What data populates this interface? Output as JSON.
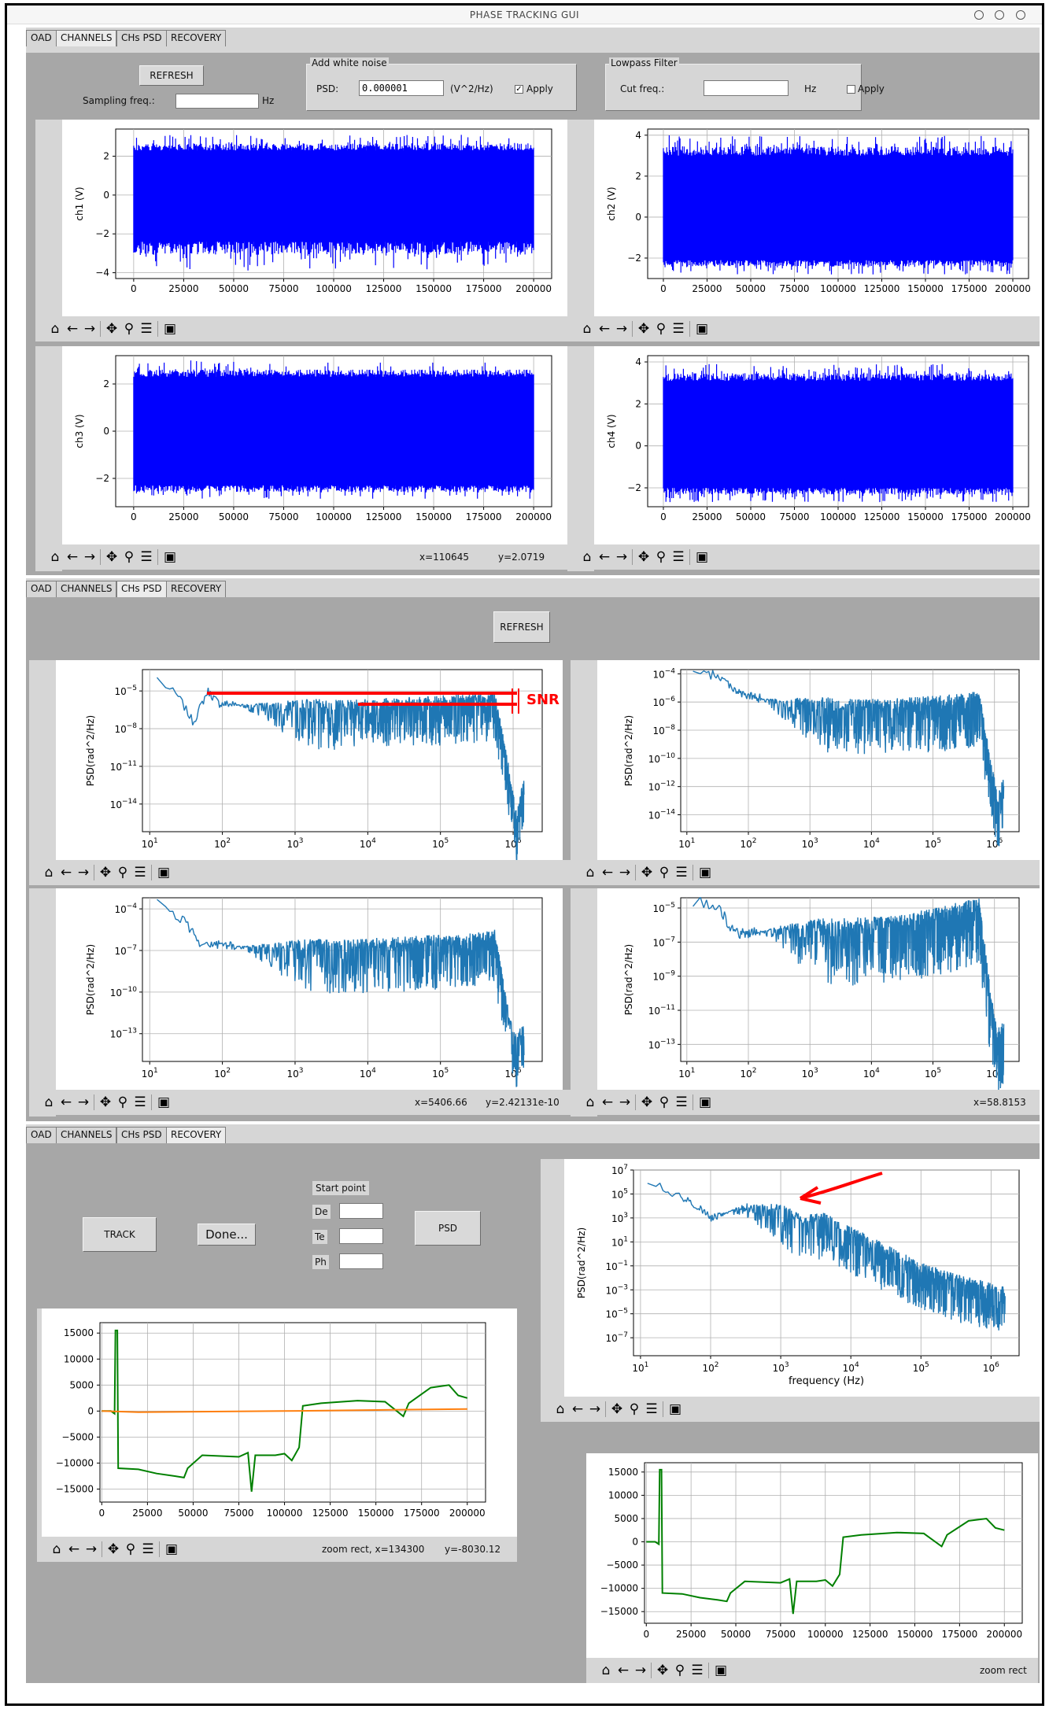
{
  "window": {
    "title": "PHASE TRACKING GUI"
  },
  "tabs": [
    "OAD",
    "CHANNELS",
    "CHs PSD",
    "RECOVERY"
  ],
  "panel1": {
    "refresh_label": "REFRESH",
    "sampling_label": "Sampling freq.:",
    "sampling_value": "",
    "hz_label": "Hz",
    "noise": {
      "title": "Add white noise",
      "psd_label": "PSD:",
      "psd_value": "0.000001",
      "unit": "(V^2/Hz)",
      "apply_label": "Apply",
      "apply_checked": true
    },
    "lowpass": {
      "title": "Lowpass Filter",
      "cut_label": "Cut freq.:",
      "cut_value": "",
      "hz_label": "Hz",
      "apply_label": "Apply",
      "apply_checked": false
    },
    "status_bottom_left": {
      "x": "x=110645",
      "y": "y=2.0719"
    }
  },
  "panel2": {
    "refresh_label": "REFRESH",
    "snr_label": "SNR",
    "status_bottom_left": {
      "x": "x=5406.66",
      "y": "y=2.42131e-10"
    },
    "status_bottom_right": {
      "x": "x=58.8153"
    }
  },
  "panel3": {
    "track_label": "TRACK",
    "done_label": "Done...",
    "psd_label": "PSD",
    "start_point_label": "Start point",
    "fields": [
      {
        "label": "De",
        "value": ""
      },
      {
        "label": "Te",
        "value": ""
      },
      {
        "label": "Ph",
        "value": ""
      }
    ],
    "status_left": {
      "x": "zoom rect, x=134300",
      "y": "y=-8030.12"
    },
    "status_right": "zoom rect"
  },
  "toolbar_icons": [
    "home-icon",
    "back-arrow-icon",
    "forward-arrow-icon",
    "pan-icon",
    "zoom-icon",
    "configure-subplots-icon",
    "save-icon"
  ],
  "colors": {
    "time_series": "#0000ff",
    "psd": "#1f77b4",
    "track_green": "#008000",
    "track_orange": "#ff7f0e",
    "annotation": "#ff0000",
    "panel_bg": "#a7a7a7",
    "toolbar_bg": "#d6d6d6"
  },
  "chart_data": [
    {
      "id": "ch1",
      "type": "line",
      "ylabel": "ch1 (V)",
      "x_range": [
        0,
        200000
      ],
      "y_ticks": [
        2,
        0,
        -2,
        -4
      ],
      "x_ticks": [
        "0",
        "25000",
        "50000",
        "75000",
        "100000",
        "125000",
        "150000",
        "175000",
        "200000"
      ],
      "ylim": [
        -4.3,
        3.4
      ],
      "band": [
        -2.4,
        2.3
      ],
      "spikes": [
        -3.9,
        3.1
      ],
      "grid": true
    },
    {
      "id": "ch2",
      "type": "line",
      "ylabel": "ch2 (V)",
      "x_range": [
        0,
        200000
      ],
      "y_ticks": [
        4,
        2,
        0,
        -2
      ],
      "x_ticks": [
        "0",
        "25000",
        "50000",
        "75000",
        "100000",
        "125000",
        "150000",
        "175000",
        "200000"
      ],
      "ylim": [
        -3.0,
        4.3
      ],
      "band": [
        -2.1,
        3.0
      ],
      "spikes": [
        -2.8,
        4.0
      ],
      "grid": true
    },
    {
      "id": "ch3",
      "type": "line",
      "ylabel": "ch3 (V)",
      "x_range": [
        0,
        200000
      ],
      "y_ticks": [
        2,
        0,
        -2
      ],
      "x_ticks": [
        "0",
        "25000",
        "50000",
        "75000",
        "100000",
        "125000",
        "150000",
        "175000",
        "200000"
      ],
      "ylim": [
        -3.2,
        3.2
      ],
      "band": [
        -2.3,
        2.3
      ],
      "spikes": [
        -2.9,
        3.0
      ],
      "grid": true
    },
    {
      "id": "ch4",
      "type": "line",
      "ylabel": "ch4 (V)",
      "x_range": [
        0,
        200000
      ],
      "y_ticks": [
        4,
        2,
        0,
        -2
      ],
      "x_ticks": [
        "0",
        "25000",
        "50000",
        "75000",
        "100000",
        "125000",
        "150000",
        "175000",
        "200000"
      ],
      "ylim": [
        -2.9,
        4.3
      ],
      "band": [
        -2.0,
        3.1
      ],
      "spikes": [
        -2.7,
        3.9
      ],
      "grid": true
    },
    {
      "id": "psd1",
      "type": "line",
      "scale": "loglog",
      "ylabel": "PSD(rad^2/Hz)",
      "x_ticks": [
        "10^1",
        "10^2",
        "10^3",
        "10^4",
        "10^5",
        "10^6"
      ],
      "y_ticks": [
        "10^-5",
        "10^-8",
        "10^-11",
        "10^-14"
      ],
      "x_log_range": [
        0.9,
        6.4
      ],
      "y_log_range": [
        -16.2,
        -3.3
      ],
      "points_log": [
        [
          1.1,
          -4.0
        ],
        [
          1.4,
          -5.5
        ],
        [
          1.6,
          -7.5
        ],
        [
          1.8,
          -5.0
        ],
        [
          1.95,
          -6.0
        ],
        [
          2.5,
          -6.2
        ],
        [
          3.5,
          -6.5
        ],
        [
          4.5,
          -6.3
        ],
        [
          5.5,
          -6.0
        ],
        [
          5.75,
          -5.8
        ],
        [
          5.95,
          -12.0
        ],
        [
          6.05,
          -15.5
        ],
        [
          6.15,
          -12.5
        ]
      ],
      "grid": true
    },
    {
      "id": "psd2",
      "type": "line",
      "scale": "loglog",
      "ylabel": "PSD(rad^2/Hz)",
      "x_ticks": [
        "10^1",
        "10^2",
        "10^3",
        "10^4",
        "10^5",
        "10^6"
      ],
      "y_ticks": [
        "10^-4",
        "10^-6",
        "10^-8",
        "10^-10",
        "10^-12",
        "10^-14"
      ],
      "x_log_range": [
        0.9,
        6.4
      ],
      "y_log_range": [
        -15.2,
        -3.7
      ],
      "points_log": [
        [
          1.1,
          -4.0
        ],
        [
          1.5,
          -4.1
        ],
        [
          1.9,
          -5.5
        ],
        [
          2.5,
          -6.0
        ],
        [
          3.5,
          -6.6
        ],
        [
          4.5,
          -6.5
        ],
        [
          5.5,
          -6.2
        ],
        [
          5.75,
          -6.0
        ],
        [
          5.95,
          -11.0
        ],
        [
          6.05,
          -13.5
        ],
        [
          6.15,
          -12.0
        ]
      ],
      "grid": true
    },
    {
      "id": "psd3",
      "type": "line",
      "scale": "loglog",
      "ylabel": "PSD(rad^2/Hz)",
      "x_ticks": [
        "10^1",
        "10^2",
        "10^3",
        "10^4",
        "10^5",
        "10^6"
      ],
      "y_ticks": [
        "10^-4",
        "10^-7",
        "10^-10",
        "10^-13"
      ],
      "x_log_range": [
        0.9,
        6.4
      ],
      "y_log_range": [
        -15.0,
        -3.2
      ],
      "points_log": [
        [
          1.1,
          -3.6
        ],
        [
          1.5,
          -5.0
        ],
        [
          1.7,
          -6.5
        ],
        [
          2.5,
          -6.8
        ],
        [
          3.5,
          -7.0
        ],
        [
          4.5,
          -6.8
        ],
        [
          5.5,
          -6.5
        ],
        [
          5.75,
          -6.3
        ],
        [
          5.95,
          -12.5
        ],
        [
          6.05,
          -14.0
        ],
        [
          6.15,
          -12.5
        ]
      ],
      "grid": true
    },
    {
      "id": "psd4",
      "type": "line",
      "scale": "loglog",
      "ylabel": "PSD(rad^2/Hz)",
      "x_ticks": [
        "10^1",
        "10^2",
        "10^3",
        "10^4",
        "10^5",
        "10^6"
      ],
      "y_ticks": [
        "10^-5",
        "10^-7",
        "10^-9",
        "10^-11",
        "10^-13"
      ],
      "x_log_range": [
        0.9,
        6.4
      ],
      "y_log_range": [
        -14.0,
        -4.4
      ],
      "points_log": [
        [
          1.1,
          -4.6
        ],
        [
          1.5,
          -5.0
        ],
        [
          1.8,
          -6.5
        ],
        [
          2.5,
          -6.3
        ],
        [
          3.5,
          -6.4
        ],
        [
          4.5,
          -6.2
        ],
        [
          5.5,
          -5.4
        ],
        [
          5.75,
          -5.2
        ],
        [
          5.95,
          -11.0
        ],
        [
          6.05,
          -13.0
        ],
        [
          6.15,
          -12.0
        ]
      ],
      "grid": true
    },
    {
      "id": "psd_recovery",
      "type": "line",
      "scale": "loglog",
      "ylabel": "PSD(rad^2/Hz)",
      "xlabel": "frequency (Hz)",
      "x_ticks": [
        "10^1",
        "10^2",
        "10^3",
        "10^4",
        "10^5",
        "10^6"
      ],
      "y_ticks": [
        "10^7",
        "10^5",
        "10^3",
        "10^1",
        "10^-1",
        "10^-3",
        "10^-5",
        "10^-7"
      ],
      "x_log_range": [
        0.9,
        6.4
      ],
      "y_log_range": [
        -8.5,
        7.0
      ],
      "points_log": [
        [
          1.1,
          6.0
        ],
        [
          1.5,
          5.0
        ],
        [
          1.8,
          4.0
        ],
        [
          2.0,
          3.0
        ],
        [
          2.5,
          4.0
        ],
        [
          3.0,
          3.5
        ],
        [
          3.3,
          2.5
        ],
        [
          3.6,
          2.7
        ],
        [
          4.0,
          1.5
        ],
        [
          4.5,
          0.0
        ],
        [
          5.0,
          -1.5
        ],
        [
          5.5,
          -2.5
        ],
        [
          6.0,
          -3.2
        ],
        [
          6.2,
          -3.5
        ]
      ],
      "grid": true
    },
    {
      "id": "track_all",
      "type": "line",
      "x_ticks": [
        "0",
        "25000",
        "50000",
        "75000",
        "100000",
        "125000",
        "150000",
        "175000",
        "200000"
      ],
      "y_ticks": [
        "15000",
        "10000",
        "5000",
        "0",
        "-5000",
        "-10000",
        "-15000"
      ],
      "xlim": [
        -1000,
        210000
      ],
      "ylim": [
        -17500,
        17000
      ],
      "series": [
        {
          "color": "#008000",
          "values": [
            [
              0,
              0
            ],
            [
              5000,
              0
            ],
            [
              7000,
              -500
            ],
            [
              7500,
              15500
            ],
            [
              8500,
              15500
            ],
            [
              9000,
              -11000
            ],
            [
              20000,
              -11200
            ],
            [
              30000,
              -12000
            ],
            [
              40000,
              -12500
            ],
            [
              45000,
              -12800
            ],
            [
              47000,
              -11000
            ],
            [
              55000,
              -8500
            ],
            [
              75000,
              -8800
            ],
            [
              80000,
              -8000
            ],
            [
              82000,
              -15500
            ],
            [
              84000,
              -8500
            ],
            [
              95000,
              -8500
            ],
            [
              100000,
              -8200
            ],
            [
              104000,
              -9500
            ],
            [
              108000,
              -7000
            ],
            [
              110000,
              1000
            ],
            [
              120000,
              1500
            ],
            [
              140000,
              2000
            ],
            [
              155000,
              1800
            ],
            [
              165000,
              -1000
            ],
            [
              168000,
              1500
            ],
            [
              180000,
              4500
            ],
            [
              190000,
              5000
            ],
            [
              195000,
              3000
            ],
            [
              200000,
              2500
            ]
          ]
        },
        {
          "color": "#ff7f0e",
          "values": [
            [
              0,
              0
            ],
            [
              20000,
              -200
            ],
            [
              60000,
              -100
            ],
            [
              100000,
              0
            ],
            [
              150000,
              200
            ],
            [
              200000,
              400
            ]
          ]
        }
      ]
    },
    {
      "id": "track_zoom",
      "type": "line",
      "x_ticks": [
        "0",
        "25000",
        "50000",
        "75000",
        "100000",
        "125000",
        "150000",
        "175000",
        "200000"
      ],
      "y_ticks": [
        "15000",
        "10000",
        "5000",
        "0",
        "-5000",
        "-10000",
        "-15000"
      ],
      "xlim": [
        -1000,
        210000
      ],
      "ylim": [
        -17500,
        17000
      ],
      "series": [
        {
          "color": "#008000",
          "values": [
            [
              0,
              0
            ],
            [
              5000,
              0
            ],
            [
              7000,
              -500
            ],
            [
              7500,
              15500
            ],
            [
              8500,
              15500
            ],
            [
              9000,
              -11000
            ],
            [
              20000,
              -11200
            ],
            [
              30000,
              -12000
            ],
            [
              40000,
              -12500
            ],
            [
              45000,
              -12800
            ],
            [
              47000,
              -11000
            ],
            [
              55000,
              -8500
            ],
            [
              75000,
              -8800
            ],
            [
              80000,
              -8000
            ],
            [
              82000,
              -15500
            ],
            [
              84000,
              -8500
            ],
            [
              95000,
              -8500
            ],
            [
              100000,
              -8200
            ],
            [
              104000,
              -9500
            ],
            [
              108000,
              -7000
            ],
            [
              110000,
              1000
            ],
            [
              120000,
              1500
            ],
            [
              140000,
              2000
            ],
            [
              155000,
              1800
            ],
            [
              165000,
              -1000
            ],
            [
              168000,
              1500
            ],
            [
              180000,
              4500
            ],
            [
              190000,
              5000
            ],
            [
              195000,
              3000
            ],
            [
              200000,
              2500
            ]
          ]
        }
      ]
    }
  ]
}
